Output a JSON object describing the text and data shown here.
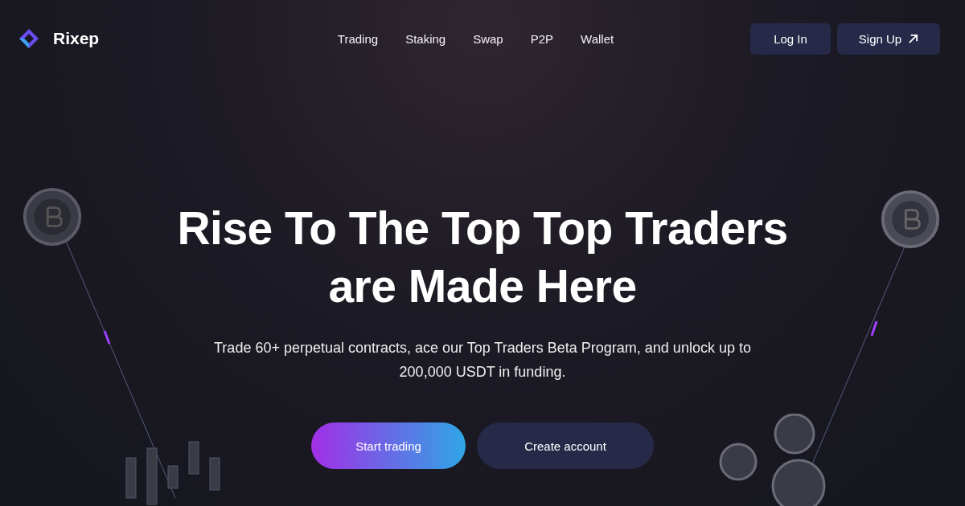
{
  "header": {
    "logo": "Rixep",
    "nav": [
      {
        "label": "Trading"
      },
      {
        "label": "Staking"
      },
      {
        "label": "Swap"
      },
      {
        "label": "P2P"
      },
      {
        "label": "Wallet"
      }
    ],
    "login": "Log In",
    "signup": "Sign Up"
  },
  "hero": {
    "title_lines": [
      "Rise To The Top Top Traders",
      "are Made Here"
    ],
    "subtitle": "Trade 60+ perpetual contracts, ace our Top Traders Beta Program, and unlock up to 200,000 USDT in funding.",
    "buttons": [
      {
        "label": "Start trading",
        "kind": "primary"
      },
      {
        "label": "Create account",
        "kind": "secondary"
      }
    ]
  }
}
